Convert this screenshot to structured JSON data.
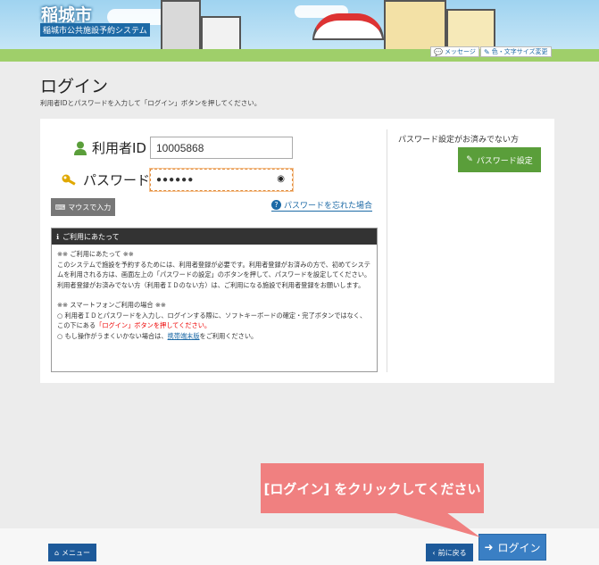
{
  "header": {
    "title": "稲城市",
    "subtitle": "稲城市公共施設予約システム",
    "message_link": "メッセージ",
    "style_link": "色・文字サイズ変更"
  },
  "page": {
    "title": "ログイン",
    "description": "利用者IDとパスワードを入力して「ログイン」ボタンを押してください。"
  },
  "form": {
    "user_id_label": "利用者ID",
    "user_id_value": "10005868",
    "password_label": "パスワード",
    "password_value": "●●●●●●",
    "mouse_input_button": "マウスで入力",
    "forgot_link": "パスワードを忘れた場合"
  },
  "notice": {
    "heading": "ご利用にあたって",
    "line1": "※※ ご利用にあたって ※※",
    "line2": "このシステムで施設を予約するためには、利用者登録が必要です。利用者登録がお済みの方で、初めてシステムを利用される方は、画面左上の「パスワードの設定」のボタンを押して、パスワードを設定してください。",
    "line3": "利用者登録がお済みでない方（利用者ＩＤのない方）は、ご利用になる施設で利用者登録をお願いします。",
    "line4": "※※ スマートフォンご利用の場合 ※※",
    "line5a": "○ 利用者ＩＤとパスワードを入力し、ログインする際に、ソフトキーボードの確定・完了ボタンではなく、この下にある",
    "line5red": "「ログイン」ボタンを押してください。",
    "line6a": "○ もし操作がうまくいかない場合は、",
    "line6link": "携帯端末版",
    "line6b": "をご利用ください。"
  },
  "side": {
    "no_password_text": "パスワード設定がお済みでない方",
    "password_setup_button": "パスワード設定"
  },
  "footer": {
    "menu_button": "メニュー",
    "back_button": "前に戻る",
    "login_button": "ログイン"
  },
  "tooltip": {
    "text": "[ログイン] をクリックしてください"
  },
  "colors": {
    "accent": "#1d5a9a",
    "login": "#3a7fc4",
    "setup": "#5a9e3a",
    "tooltip": "#f08080",
    "focus": "#e08c3e"
  }
}
